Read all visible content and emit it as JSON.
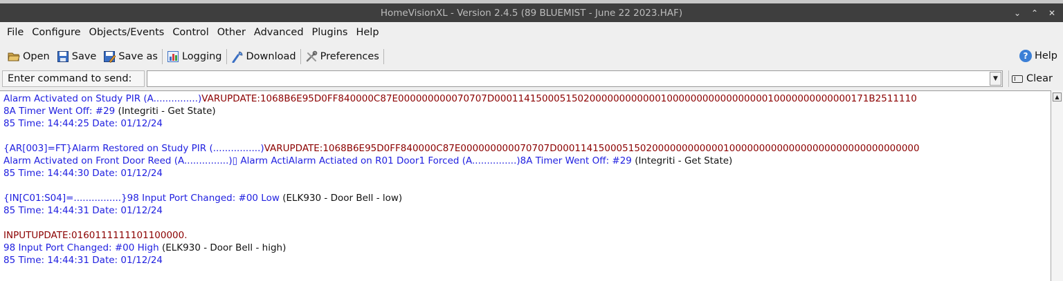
{
  "window": {
    "title": "HomeVisionXL - Version 2.4.5 (89 BLUEMIST - June 22 2023.HAF)"
  },
  "menu": [
    "File",
    "Configure",
    "Objects/Events",
    "Control",
    "Other",
    "Advanced",
    "Plugins",
    "Help"
  ],
  "toolbar": {
    "open": "Open",
    "save": "Save",
    "save_as": "Save as",
    "logging": "Logging",
    "download": "Download",
    "preferences": "Preferences",
    "help": "Help"
  },
  "command": {
    "label": "Enter command to send:",
    "value": "",
    "clear": "Clear"
  },
  "log": [
    [
      {
        "c": "blue",
        "t": "Alarm Activated on Study PIR (A...............)"
      },
      {
        "c": "red",
        "t": "VARUPDATE:1068B6E95D0FF840000C87E000000000070707D000114150005150200000000000010000000000000000010000000000000171B2511110"
      }
    ],
    [
      {
        "c": "blue",
        "t": "8A Timer Went Off: #29 "
      },
      {
        "c": "blk",
        "t": "(Integriti - Get State)"
      }
    ],
    [
      {
        "c": "blue",
        "t": "85 Time: 14:44:25  Date: 01/12/24"
      }
    ],
    [],
    [
      {
        "c": "blue",
        "t": "{AR[003]=FT}Alarm Restored on Study PIR (................)"
      },
      {
        "c": "red",
        "t": "VARUPDATE:1068B6E95D0FF840000C87E000000000070707D0001141500051502000000000000100000000000000000000000000000000"
      }
    ],
    [
      {
        "c": "blue",
        "t": "Alarm Activated on Front Door Reed (A...............)▯ Alarm ActiAlarm Actiated on R01 Door1 Forced (A...............)8A Timer Went Off: #29 "
      },
      {
        "c": "blk",
        "t": "(Integriti - Get State)"
      }
    ],
    [
      {
        "c": "blue",
        "t": "85 Time: 14:44:30  Date: 01/12/24"
      }
    ],
    [],
    [
      {
        "c": "blue",
        "t": "{IN[C01:S04]=................}98 Input Port Changed: #00 Low "
      },
      {
        "c": "blk",
        "t": "(ELK930 - Door Bell - low)"
      }
    ],
    [
      {
        "c": "blue",
        "t": "85 Time: 14:44:31  Date: 01/12/24"
      }
    ],
    [],
    [
      {
        "c": "red",
        "t": "INPUTUPDATE:0160111111101100000."
      }
    ],
    [
      {
        "c": "blue",
        "t": "98 Input Port Changed: #00 High "
      },
      {
        "c": "blk",
        "t": "(ELK930 - Door Bell - high)"
      }
    ],
    [
      {
        "c": "blue",
        "t": "85 Time: 14:44:31  Date: 01/12/24"
      }
    ]
  ]
}
